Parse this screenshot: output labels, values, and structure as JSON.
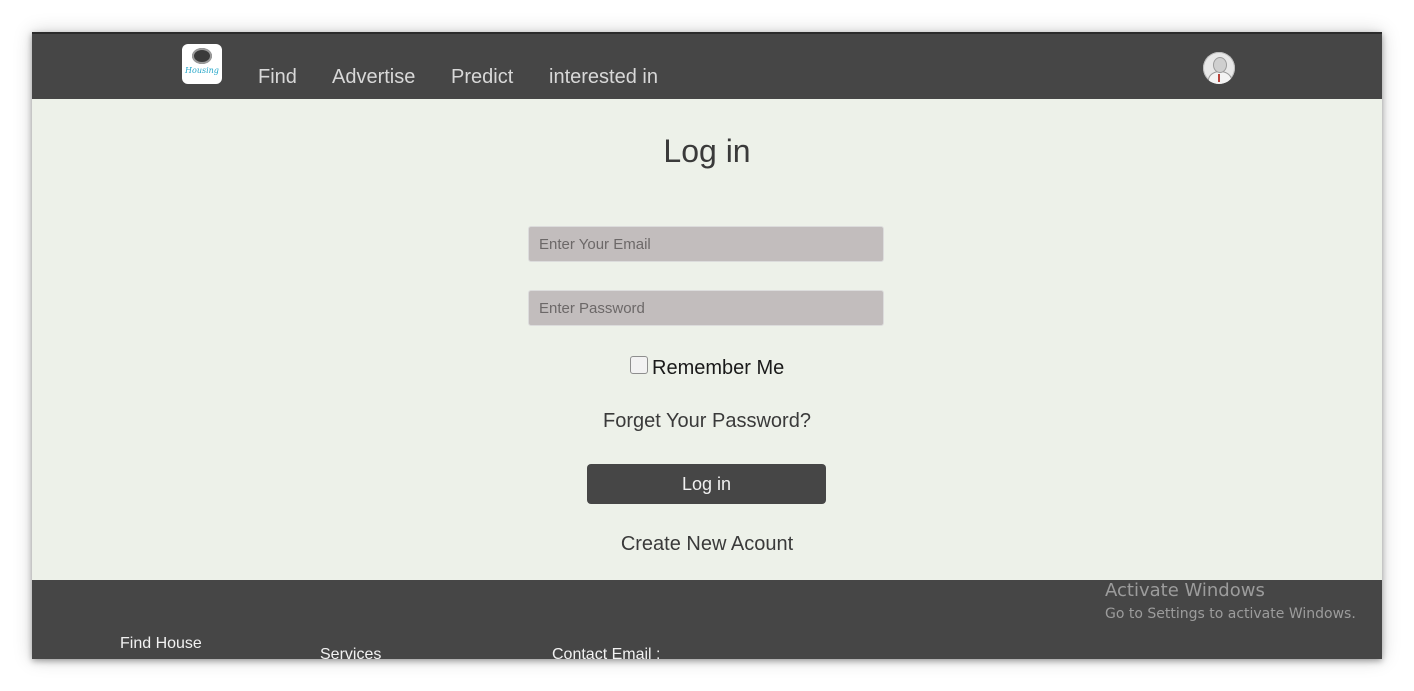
{
  "nav": {
    "logo_text": "Housing",
    "links": [
      "Find",
      "Advertise",
      "Predict",
      "interested in"
    ]
  },
  "login": {
    "title": "Log in",
    "email_placeholder": "Enter Your Email",
    "password_placeholder": "Enter Password",
    "remember_label": "Remember Me",
    "forgot_label": "Forget Your Password?",
    "submit_label": "Log in",
    "create_label": "Create New Acount"
  },
  "footer": {
    "find_house": "Find House",
    "services": "Services",
    "contact": "Contact Email :"
  },
  "watermark": {
    "title": "Activate Windows",
    "subtitle": "Go to Settings to activate Windows."
  },
  "icons": {
    "logo": "housing-logo-icon",
    "avatar": "user-avatar-icon"
  },
  "colors": {
    "navbar": "#464646",
    "page_background": "#edf1e9",
    "input_background": "#c2bdbd",
    "button": "#464646"
  }
}
